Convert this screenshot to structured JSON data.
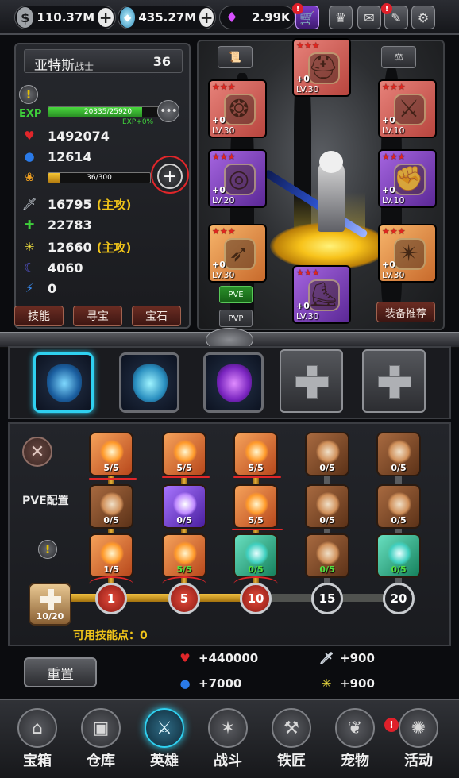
{
  "currencies": {
    "gold": {
      "icon": "dollar-icon",
      "value": "110.37M"
    },
    "diamonds": {
      "icon": "diamond-icon",
      "value": "435.27M"
    },
    "gems": {
      "icon": "purple-gem-icon",
      "value": "2.99K"
    }
  },
  "hero": {
    "name": "亚特斯",
    "class": "战士",
    "level": "36",
    "exp_label": "EXP",
    "exp_text": "20335/25920",
    "exp_fraction": 0.785,
    "exp_bonus": "EXP+0%",
    "pet_text": "36/300",
    "pet_fraction": 0.12
  },
  "stats": [
    {
      "icon": "heart-icon",
      "glyph": "♥",
      "color": "#e0262a",
      "value": "1492074",
      "tag": ""
    },
    {
      "icon": "blue-drop-icon",
      "glyph": "●",
      "color": "#2a7ae8",
      "value": "12614",
      "tag": ""
    },
    {
      "icon": "sword-icon",
      "glyph": "🗡",
      "color": "#cfd6de",
      "value": "16795",
      "tag": "(主攻)"
    },
    {
      "icon": "green-star-icon",
      "glyph": "✚",
      "color": "#3fd03b",
      "value": "22783",
      "tag": ""
    },
    {
      "icon": "yellow-burst-icon",
      "glyph": "✳",
      "color": "#f0e040",
      "value": "12660",
      "tag": "(主攻)"
    },
    {
      "icon": "moon-icon",
      "glyph": "☾",
      "color": "#5a5ae0",
      "value": "4060",
      "tag": ""
    },
    {
      "icon": "lightning-icon",
      "glyph": "⚡",
      "color": "#3a8cf0",
      "value": "0",
      "tag": ""
    }
  ],
  "panel_buttons": [
    "技能",
    "寻宝",
    "宝石"
  ],
  "equipment": [
    {
      "name": "helmet",
      "lv": "LV.30",
      "plus": "+0",
      "rarity": "red"
    },
    {
      "name": "amulet",
      "lv": "LV.30",
      "plus": "+0",
      "rarity": "red"
    },
    {
      "name": "armor",
      "lv": "LV.10",
      "plus": "+0",
      "rarity": "red"
    },
    {
      "name": "ring",
      "lv": "LV.20",
      "plus": "+0",
      "rarity": "purple"
    },
    {
      "name": "gloves",
      "lv": "LV.10",
      "plus": "+0",
      "rarity": "purple"
    },
    {
      "name": "bow",
      "lv": "LV.30",
      "plus": "+0",
      "rarity": "orange"
    },
    {
      "name": "shuriken",
      "lv": "LV.30",
      "plus": "+0",
      "rarity": "orange"
    },
    {
      "name": "boots",
      "lv": "LV.30",
      "plus": "+0",
      "rarity": "purple"
    }
  ],
  "mode_buttons": {
    "pve": "PVE",
    "pvp": "PVP"
  },
  "recommend": "装备推荐",
  "skill_tree": {
    "config_label": "PVE配置",
    "skills": [
      {
        "count": "5/5",
        "col": 0,
        "row": 0
      },
      {
        "count": "5/5",
        "col": 1,
        "row": 0
      },
      {
        "count": "5/5",
        "col": 2,
        "row": 0
      },
      {
        "count": "0/5",
        "col": 3,
        "row": 0
      },
      {
        "count": "0/5",
        "col": 4,
        "row": 0
      },
      {
        "count": "0/5",
        "col": 0,
        "row": 1
      },
      {
        "count": "0/5",
        "col": 1,
        "row": 1
      },
      {
        "count": "5/5",
        "col": 2,
        "row": 1
      },
      {
        "count": "0/5",
        "col": 3,
        "row": 1
      },
      {
        "count": "0/5",
        "col": 4,
        "row": 1
      },
      {
        "count": "1/5",
        "col": 0,
        "row": 2
      },
      {
        "count": "5/5",
        "col": 1,
        "row": 2
      },
      {
        "count": "0/5",
        "col": 2,
        "row": 2
      },
      {
        "count": "0/5",
        "col": 3,
        "row": 2
      },
      {
        "count": "0/5",
        "col": 4,
        "row": 2
      }
    ],
    "nodes": [
      "1",
      "5",
      "10",
      "15",
      "20"
    ],
    "cap_text": "10/20",
    "points_label": "可用技能点：0"
  },
  "reset_label": "重置",
  "bonuses": [
    {
      "icon": "heart-icon",
      "glyph": "♥",
      "color": "#e0262a",
      "value": "+440000"
    },
    {
      "icon": "sword-icon",
      "glyph": "🗡",
      "color": "#cfd6de",
      "value": "+900"
    },
    {
      "icon": "blue-drop-icon",
      "glyph": "●",
      "color": "#2a7ae8",
      "value": "+7000"
    },
    {
      "icon": "yellow-burst-icon",
      "glyph": "✳",
      "color": "#f0e040",
      "value": "+900"
    }
  ],
  "nav": [
    {
      "label": "宝箱",
      "icon": "chest-icon",
      "glyph": "⌂"
    },
    {
      "label": "仓库",
      "icon": "backpack-icon",
      "glyph": "▣"
    },
    {
      "label": "英雄",
      "icon": "hero-icon",
      "glyph": "⚔"
    },
    {
      "label": "战斗",
      "icon": "battle-icon",
      "glyph": "✶"
    },
    {
      "label": "铁匠",
      "icon": "anvil-icon",
      "glyph": "⚒"
    },
    {
      "label": "宠物",
      "icon": "pet-icon",
      "glyph": "❦"
    },
    {
      "label": "活动",
      "icon": "event-icon",
      "glyph": "✺"
    }
  ]
}
